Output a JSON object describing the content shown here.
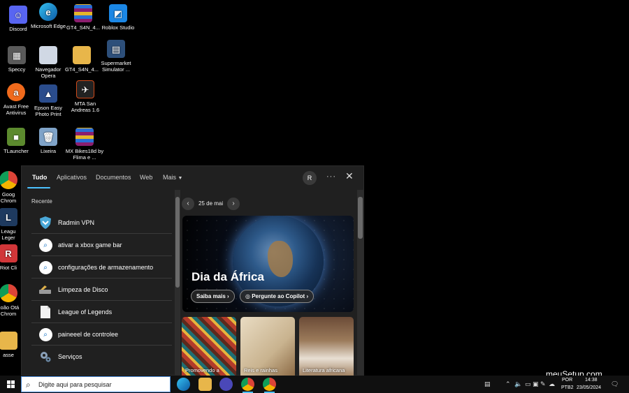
{
  "desktop": {
    "icons": [
      {
        "label": "Discord"
      },
      {
        "label": "Microsoft Edge"
      },
      {
        "label": "GT4_S4N_4..."
      },
      {
        "label": "Roblox Studio"
      },
      {
        "label": "Speccy"
      },
      {
        "label": "Navegador Opera"
      },
      {
        "label": "GT4_S4N_4..."
      },
      {
        "label": "Supermarket Simulator ..."
      },
      {
        "label": "Avast Free Antivirus"
      },
      {
        "label": "Epson Easy Photo Print"
      },
      {
        "label": "MTA San Andreas 1.6"
      },
      {
        "label": "TLauncher"
      },
      {
        "label": "Lixeira"
      },
      {
        "label": "MX Bikes18d by Flima e ..."
      },
      {
        "label": "Goog Chrom"
      },
      {
        "label": "Leagu Leger"
      },
      {
        "label": "Riot Cli"
      },
      {
        "label": "João Otá Chrom"
      },
      {
        "label": "asse"
      }
    ]
  },
  "search_panel": {
    "tabs": [
      "Tudo",
      "Aplicativos",
      "Documentos",
      "Web",
      "Mais"
    ],
    "avatar_initial": "R",
    "recent_heading": "Recente",
    "recent_items": [
      {
        "label": "Radmin VPN",
        "icon": "radmin-vpn-icon"
      },
      {
        "label": "ativar a xbox game bar",
        "icon": "search-icon"
      },
      {
        "label": "configurações de armazenamento",
        "icon": "search-icon"
      },
      {
        "label": "Limpeza de Disco",
        "icon": "disk-cleanup-icon"
      },
      {
        "label": "League of Legends",
        "icon": "document-icon"
      },
      {
        "label": "paineeel de controlee",
        "icon": "search-icon"
      },
      {
        "label": "Serviços",
        "icon": "services-gear-icon"
      }
    ],
    "date_label": "25 de mai",
    "hero": {
      "title": "Dia da África",
      "learn_more": "Saiba mais",
      "ask_copilot": "Pergunte ao Copilot"
    },
    "cards": [
      {
        "caption": "Promovendo a"
      },
      {
        "caption": "Reis e rainhas"
      },
      {
        "caption": "Literatura africana"
      }
    ]
  },
  "taskbar": {
    "search_placeholder": "Digite aqui para pesquisar",
    "lang_top": "POR",
    "lang_bottom": "PTB2",
    "time": "14:38",
    "date": "23/05/2024"
  },
  "watermark": "meuSetup.com",
  "colors": {
    "accent": "#4cc2ff",
    "panel_bg": "#202020",
    "taskbar_bg": "#101010"
  }
}
